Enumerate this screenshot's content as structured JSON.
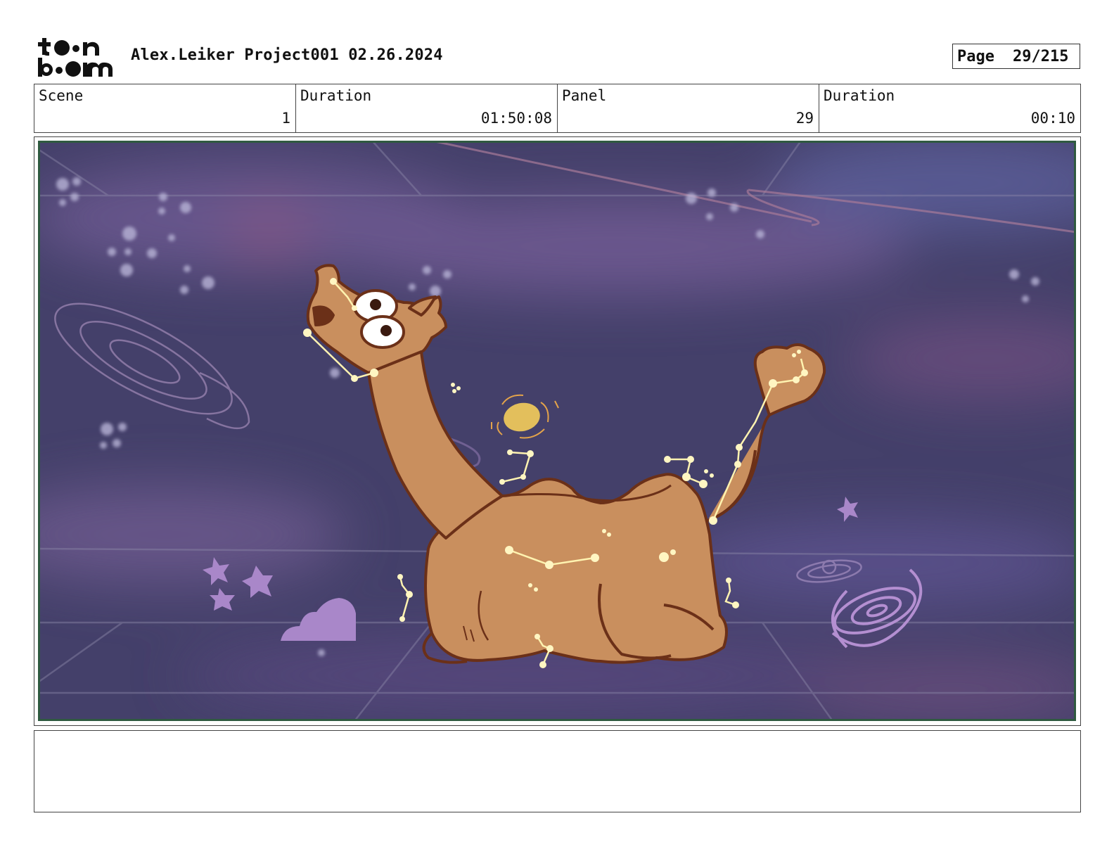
{
  "header": {
    "title": "Alex.Leiker Project001 02.26.2024",
    "page_label": "Page",
    "page_value": "29/215"
  },
  "info": {
    "scene_label": "Scene",
    "scene_value": "1",
    "scene_duration_label": "Duration",
    "scene_duration_value": "01:50:08",
    "panel_label": "Panel",
    "panel_value": "29",
    "panel_duration_label": "Duration",
    "panel_duration_value": "00:10"
  },
  "panel": {
    "icons": [
      "toon-boom-logo",
      "camel-character",
      "constellation-icon",
      "spiral-galaxy-icon",
      "star-icon",
      "cloud-icon",
      "planet-icon"
    ]
  },
  "notes": {
    "text": ""
  },
  "colors": {
    "space_background": "#45406a",
    "nebula": "#7a5a8e",
    "camel_body": "#c98f5e",
    "camel_outline": "#6b3018",
    "constellation": "#fff3b0",
    "lilac_shapes": "#a987c9",
    "frame_border": "#2f5a40"
  }
}
